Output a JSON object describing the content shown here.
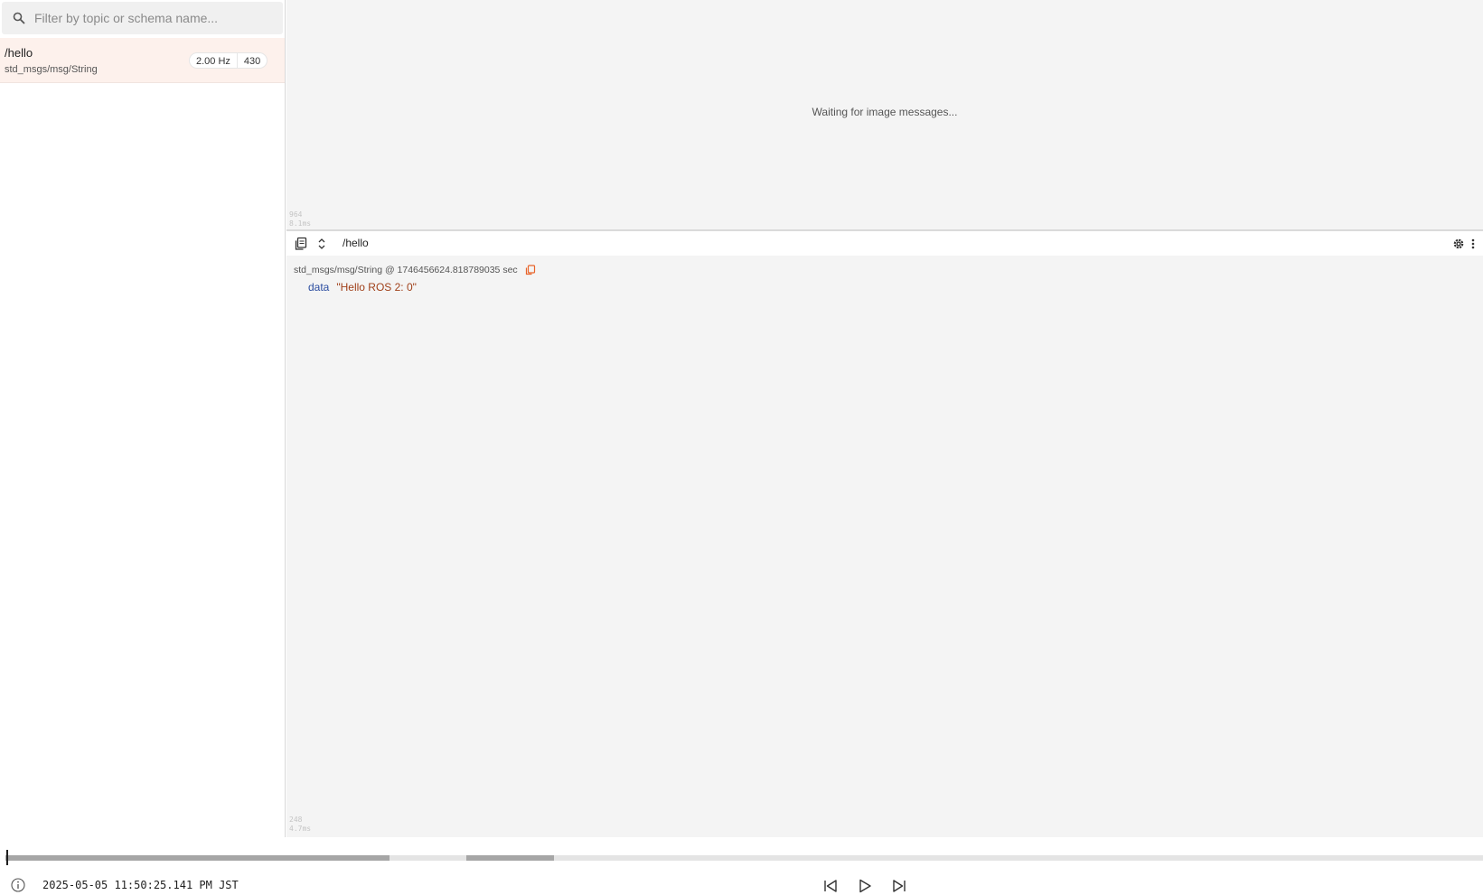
{
  "sidebar": {
    "search": {
      "placeholder": "Filter by topic or schema name..."
    },
    "topics": [
      {
        "name": "/hello",
        "schema": "std_msgs/msg/String",
        "rate": "2.00 Hz",
        "count": "430"
      }
    ]
  },
  "image_panel": {
    "waiting_text": "Waiting for image messages...",
    "perf": {
      "value": "964",
      "time": "8.1ms"
    }
  },
  "raw_panel": {
    "topic": "/hello",
    "header": "std_msgs/msg/String @ 1746456624.818789035 sec",
    "field": {
      "key": "data",
      "value": "\"Hello ROS 2: 0\""
    },
    "perf": {
      "value": "248",
      "time": "4.7ms"
    }
  },
  "playback": {
    "timestamp": "2025-05-05 11:50:25.141 PM JST"
  },
  "colors": {
    "accent": "#e8632a",
    "selected_row": "#fdf1ec",
    "panel_bg": "#f4f4f4"
  },
  "icons": [
    "search-icon",
    "copy-messages-icon",
    "expand-collapse-icon",
    "copy-icon",
    "settings-icon",
    "more-icon",
    "info-icon",
    "seek-backward-icon",
    "play-icon",
    "seek-forward-icon"
  ]
}
